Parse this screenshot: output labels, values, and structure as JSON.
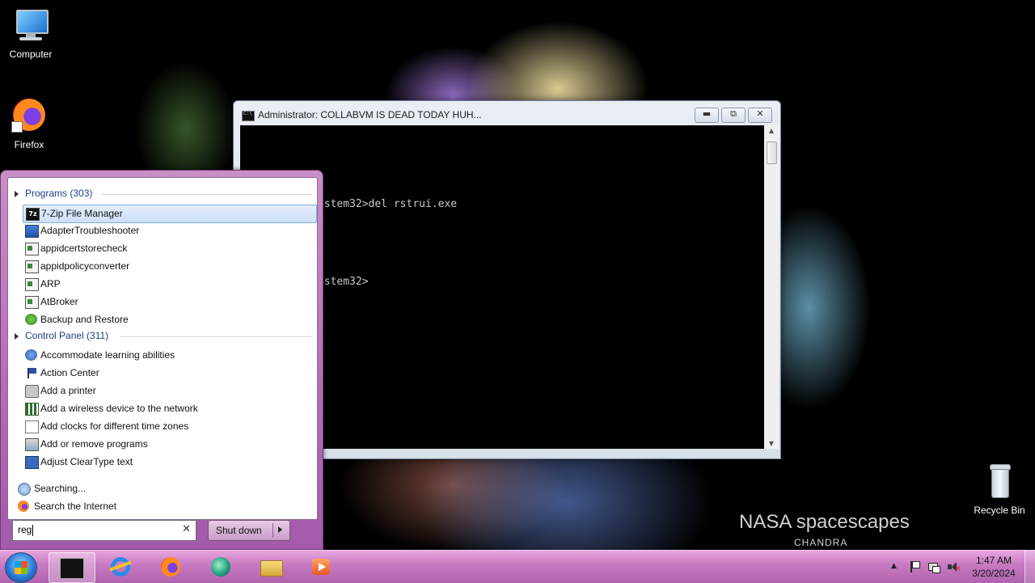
{
  "desktop": {
    "wallpaper_caption": "NASA spacescapes",
    "wallpaper_credit": "CHANDRA",
    "icons": [
      {
        "label": "Computer",
        "icon": "computer-icon"
      },
      {
        "label": "Firefox",
        "icon": "firefox-icon"
      },
      {
        "label": "Recycle Bin",
        "icon": "recycle-bin-icon"
      }
    ]
  },
  "console": {
    "title": "Administrator:  COLLABVM IS DEAD TODAY HUH...",
    "lines": [
      "C:\\Windows\\system32>del rstrui.exe",
      "C:\\Windows\\system32>"
    ],
    "buttons": {
      "minimize": "minimize-icon",
      "restore": "restore-icon",
      "close": "close-icon"
    }
  },
  "start_menu": {
    "groups": [
      {
        "header": "Programs (303)",
        "items": [
          {
            "label": "7-Zip File Manager",
            "icon": "7zip-icon",
            "selected": true
          },
          {
            "label": "AdapterTroubleshooter",
            "icon": "monitor-icon"
          },
          {
            "label": "appidcertstorecheck",
            "icon": "application-icon"
          },
          {
            "label": "appidpolicyconverter",
            "icon": "application-icon"
          },
          {
            "label": "ARP",
            "icon": "application-icon"
          },
          {
            "label": "AtBroker",
            "icon": "application-icon"
          },
          {
            "label": "Backup and Restore",
            "icon": "backup-icon"
          }
        ]
      },
      {
        "header": "Control Panel (311)",
        "items": [
          {
            "label": "Accommodate learning abilities",
            "icon": "ease-of-access-icon"
          },
          {
            "label": "Action Center",
            "icon": "flag-icon"
          },
          {
            "label": "Add a printer",
            "icon": "printer-icon"
          },
          {
            "label": "Add a wireless device to the network",
            "icon": "network-icon"
          },
          {
            "label": "Add clocks for different time zones",
            "icon": "clock-icon"
          },
          {
            "label": "Add or remove programs",
            "icon": "programs-icon"
          },
          {
            "label": "Adjust ClearType text",
            "icon": "cleartype-icon"
          }
        ]
      }
    ],
    "searching_label": "Searching...",
    "search_internet_label": "Search the Internet",
    "search_value": "reg",
    "shutdown_label": "Shut down"
  },
  "taskbar": {
    "pinned": [
      "cmd-icon",
      "internet-explorer-icon",
      "firefox-icon",
      "remote-chat-icon",
      "explorer-icon",
      "media-player-icon"
    ],
    "clock_time": "1:47 AM",
    "clock_date": "3/20/2024",
    "tray": [
      "show-hidden-icons",
      "action-center-flag-icon",
      "network-icon",
      "volume-muted-icon"
    ]
  }
}
